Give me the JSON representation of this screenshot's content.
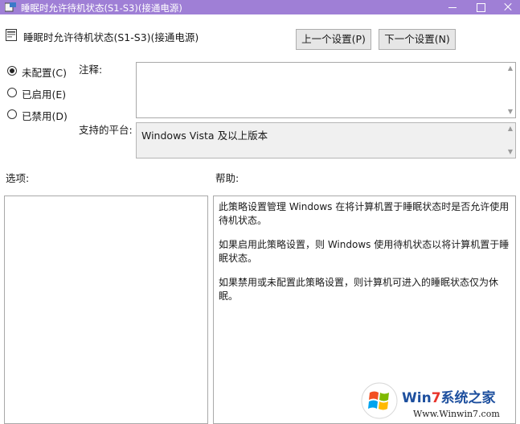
{
  "window": {
    "title": "睡眠时允许待机状态(S1-S3)(接通电源)",
    "setting_name": "睡眠时允许待机状态(S1-S3)(接通电源)"
  },
  "nav": {
    "prev_label": "上一个设置(P)",
    "next_label": "下一个设置(N)"
  },
  "state": {
    "options": [
      {
        "label": "未配置(C)",
        "selected": true
      },
      {
        "label": "已启用(E)",
        "selected": false
      },
      {
        "label": "已禁用(D)",
        "selected": false
      }
    ]
  },
  "fields": {
    "comment_label": "注释:",
    "comment_value": "",
    "platform_label": "支持的平台:",
    "platform_value": "Windows Vista 及以上版本"
  },
  "panes": {
    "options_label": "选项:",
    "help_label": "帮助:",
    "help_paragraphs": [
      "此策略设置管理 Windows 在将计算机置于睡眠状态时是否允许使用待机状态。",
      "如果启用此策略设置，则 Windows 使用待机状态以将计算机置于睡眠状态。",
      "如果禁用或未配置此策略设置，则计算机可进入的睡眠状态仅为休眠。"
    ]
  },
  "watermark": {
    "title_prefix": "Win",
    "title_seven": "7",
    "title_suffix": "系统之家",
    "url": "Www.Winwin7.com"
  }
}
